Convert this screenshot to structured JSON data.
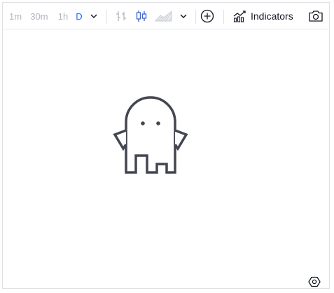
{
  "toolbar": {
    "intervals": [
      {
        "label": "1m",
        "active": false
      },
      {
        "label": "30m",
        "active": false
      },
      {
        "label": "1h",
        "active": false
      },
      {
        "label": "D",
        "active": true
      }
    ],
    "interval_dropdown_icon": "chevron-down-icon",
    "chart_types": [
      {
        "icon": "bars-icon",
        "active": false
      },
      {
        "icon": "candles-icon",
        "active": true
      },
      {
        "icon": "area-icon",
        "active": false
      }
    ],
    "chart_type_dropdown_icon": "chevron-down-icon",
    "compare_icon": "plus-circle-icon",
    "indicators": {
      "label": "Indicators",
      "icon": "indicators-icon"
    },
    "snapshot_icon": "camera-icon"
  },
  "chart_area": {
    "placeholder_icon": "ghost-icon"
  },
  "footer": {
    "settings_icon": "settings-icon"
  },
  "colors": {
    "accent": "#2962ff",
    "inactive": "#b2b5be",
    "icon": "#131722",
    "ghost": "#434651",
    "border": "#dfe1e5"
  }
}
